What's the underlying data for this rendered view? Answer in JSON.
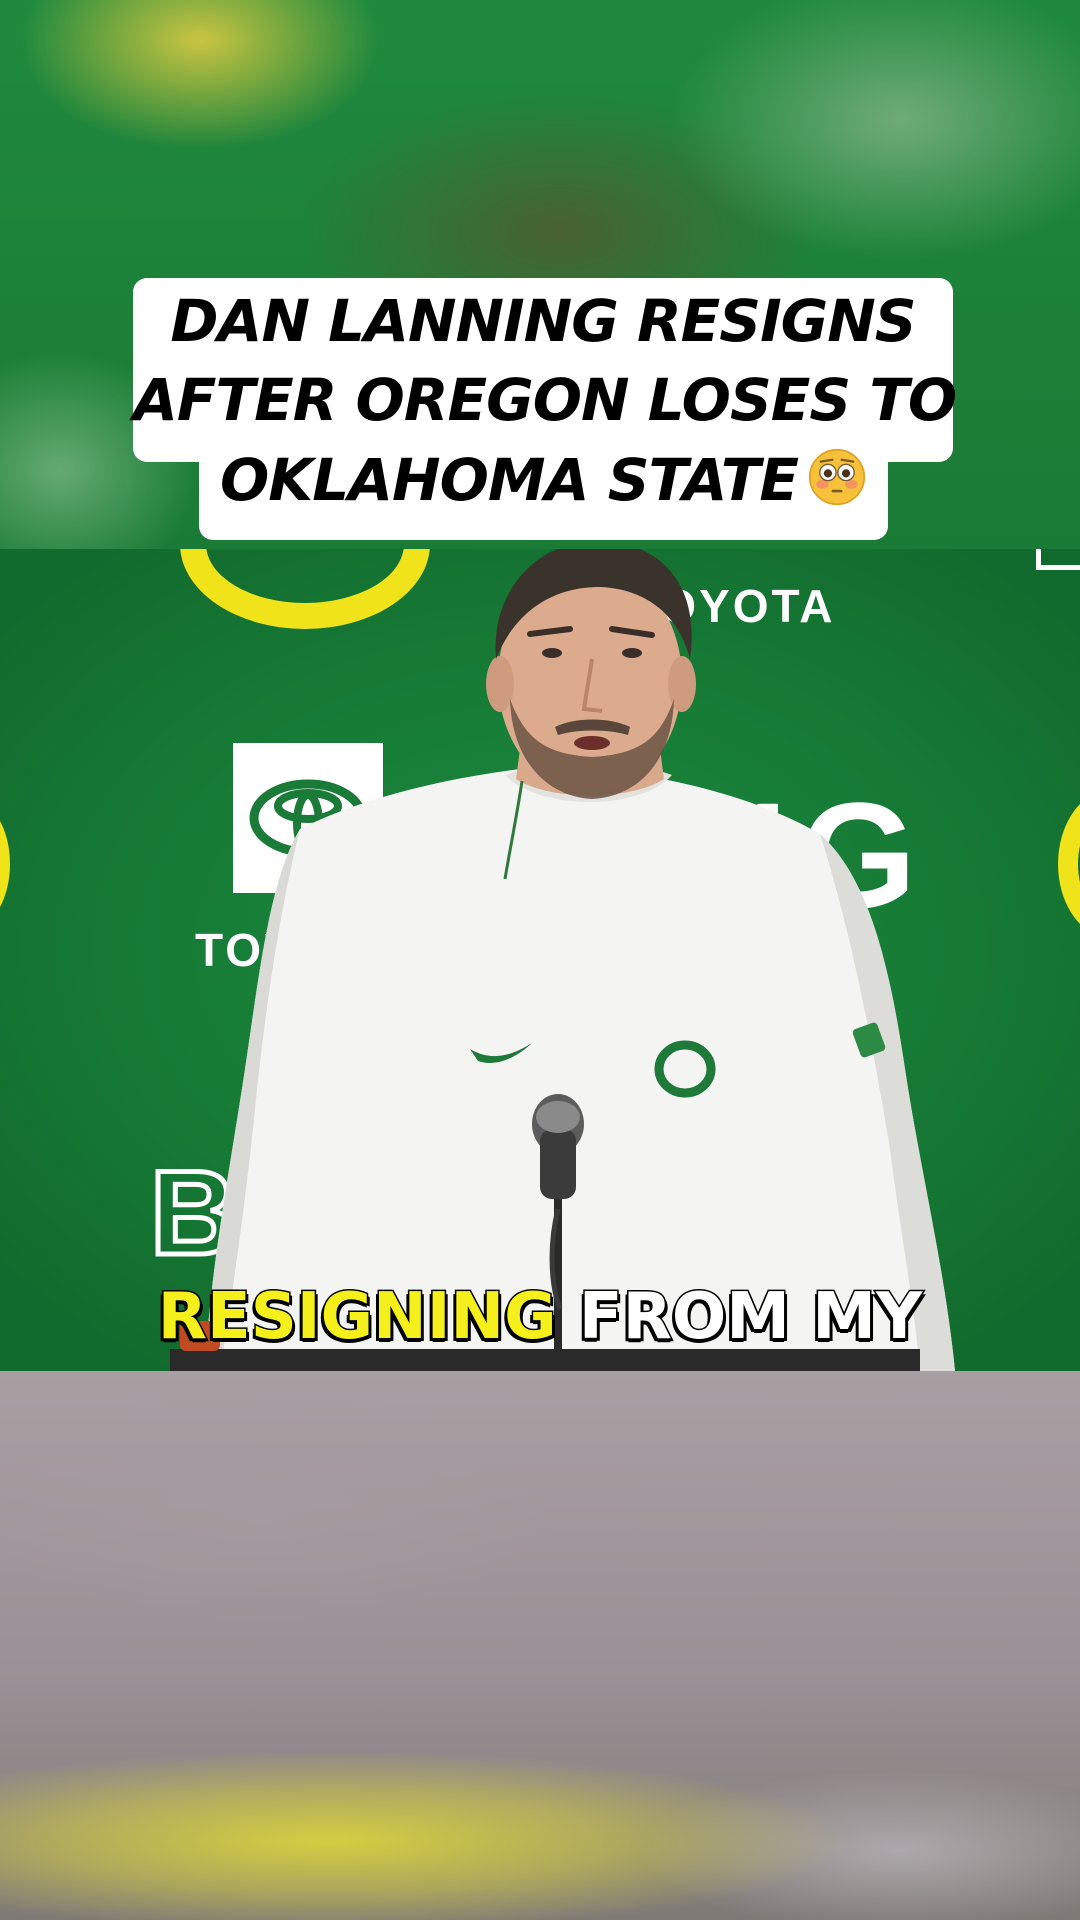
{
  "title": {
    "lines": [
      "DAN LANNING RESIGNS",
      "AFTER OREGON LOSES TO",
      "OKLAHOMA STATE"
    ],
    "emoji": "flushed-face-emoji"
  },
  "backdrop": {
    "sponsor_top": "TOYOTA",
    "sponsor_left": "TOYO",
    "conference_logo": "B1G"
  },
  "caption": {
    "highlight_word": "RESIGNING",
    "rest": "FROM MY"
  },
  "colors": {
    "oregon_green": "#1a8a3e",
    "oregon_yellow": "#f0e31a",
    "caption_highlight": "#f5f01c"
  }
}
